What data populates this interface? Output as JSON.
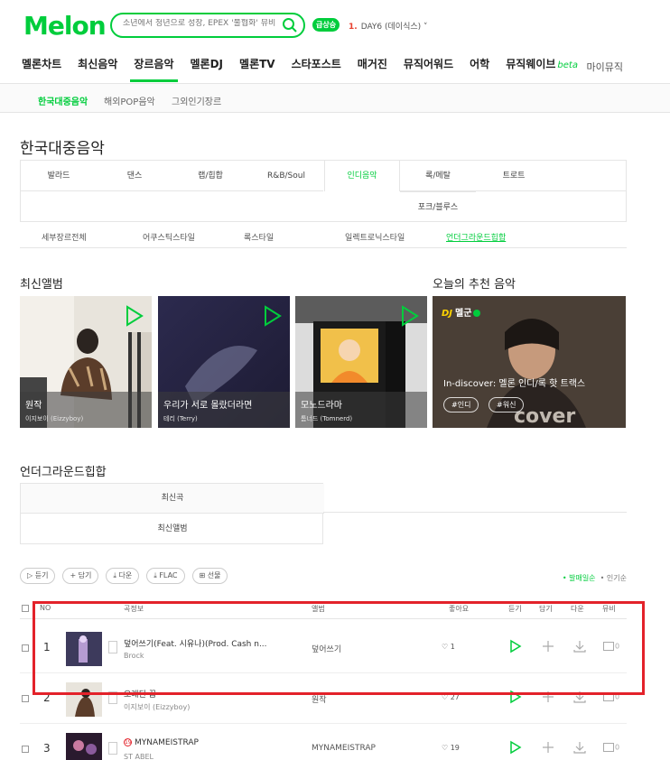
{
  "header": {
    "logo": "Melon",
    "search_placeholder": "소년에서 청년으로 성장, EPEX '불협화' 뮤비",
    "live_badge": "급상승",
    "ticker_rank": "1.",
    "ticker_text": "DAY6 (데이식스)"
  },
  "gnb": {
    "items": [
      "멜론차트",
      "최신음악",
      "장르음악",
      "멜론DJ",
      "멜론TV",
      "스타포스트",
      "매거진",
      "뮤직어워드",
      "어학",
      "뮤직웨이브"
    ],
    "beta": "beta",
    "my_music": "마이뮤직"
  },
  "subnav": [
    "한국대중음악",
    "해외POP음악",
    "그외인기장르"
  ],
  "page_title": "한국대중음악",
  "genres": [
    "발라드",
    "댄스",
    "랩/힙합",
    "R&B/Soul",
    "인디음악",
    "록/메탈",
    "트로트",
    "포크/블루스"
  ],
  "styles": [
    "세부장르전체",
    "어쿠스틱스타일",
    "록스타일",
    "일렉트로닉스타일",
    "언더그라운드힙합"
  ],
  "latest_albums_title": "최신앨범",
  "albums": [
    {
      "title": "원작",
      "artist": "이지보이 (Eizzyboy)"
    },
    {
      "title": "우리가 서로 몰랐더라면",
      "artist": "테리 (Terry)"
    },
    {
      "title": "모노드라마",
      "artist": "톰너드 (Tomnerd)"
    }
  ],
  "reco_title": "오늘의 추천 음악",
  "reco": {
    "dj_mark": "DJ",
    "dj_name": "멜군",
    "title": "In-discover: 멜론 인디/록 핫 트랙스",
    "tags": [
      "#인디",
      "#워신"
    ]
  },
  "underground_title": "언더그라운드힙합",
  "tabs": [
    "최신곡",
    "최신앨범"
  ],
  "actions": [
    "듣기",
    "+ 담기",
    "다운",
    "FLAC",
    "선물"
  ],
  "sort": {
    "active": "발매일순",
    "other": "인기순"
  },
  "table_headers": [
    "NO",
    "곡정보",
    "앨범",
    "좋아요",
    "듣기",
    "담기",
    "다운",
    "뮤비"
  ],
  "rows": [
    {
      "no": "1",
      "song": "덮어쓰기(Feat. 시유나)(Prod. Cash n...",
      "artist": "Brock",
      "album": "덮어쓰기",
      "likes": "1",
      "mv": "0"
    },
    {
      "no": "2",
      "song": "오래된 꿈",
      "artist": "이지보이 (Eizzyboy)",
      "album": "원작",
      "likes": "27",
      "mv": "0"
    },
    {
      "no": "3",
      "song": "MYNAMEISTRAP",
      "artist": "ST ABEL",
      "album": "MYNAMEISTRAP",
      "likes": "19",
      "mv": "0"
    }
  ]
}
